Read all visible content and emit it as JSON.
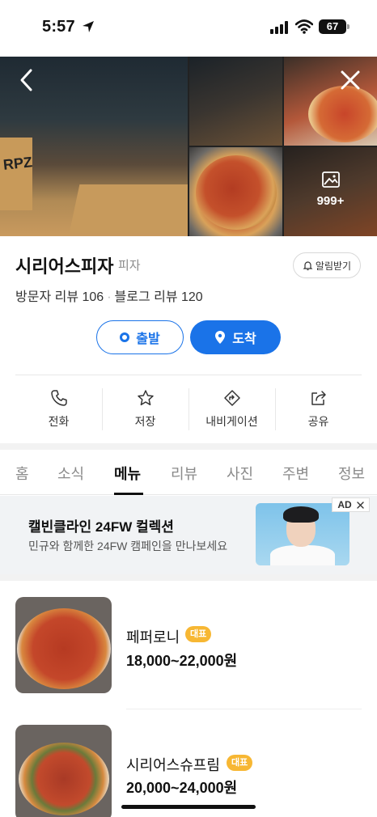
{
  "status_bar": {
    "time": "5:57",
    "battery": "67"
  },
  "gallery": {
    "more_count": "999+",
    "counter_text": "RPZ"
  },
  "place": {
    "name": "시리어스피자",
    "category": "피자",
    "notify_label": "알림받기",
    "visitor_reviews": "방문자 리뷰 106",
    "blog_reviews": "블로그 리뷰 120"
  },
  "route": {
    "depart_label": "출발",
    "arrive_label": "도착"
  },
  "actions": [
    {
      "label": "전화",
      "icon": "phone-icon"
    },
    {
      "label": "저장",
      "icon": "star-icon"
    },
    {
      "label": "내비게이션",
      "icon": "navigation-icon"
    },
    {
      "label": "공유",
      "icon": "share-icon"
    }
  ],
  "tabs": [
    {
      "label": "홈",
      "active": false
    },
    {
      "label": "소식",
      "active": false
    },
    {
      "label": "메뉴",
      "active": true
    },
    {
      "label": "리뷰",
      "active": false
    },
    {
      "label": "사진",
      "active": false
    },
    {
      "label": "주변",
      "active": false
    },
    {
      "label": "정보",
      "active": false
    }
  ],
  "ad": {
    "title": "캘빈클라인 24FW 컬렉션",
    "subtitle": "민규와 함께한 24FW 캠페인을 만나보세요",
    "badge": "AD"
  },
  "menu": [
    {
      "name": "페퍼로니",
      "badge": "대표",
      "price": "18,000~22,000원"
    },
    {
      "name": "시리어스슈프림",
      "badge": "대표",
      "price": "20,000~24,000원"
    }
  ],
  "colors": {
    "accent": "#1a73e8",
    "badge": "#f7b733"
  }
}
